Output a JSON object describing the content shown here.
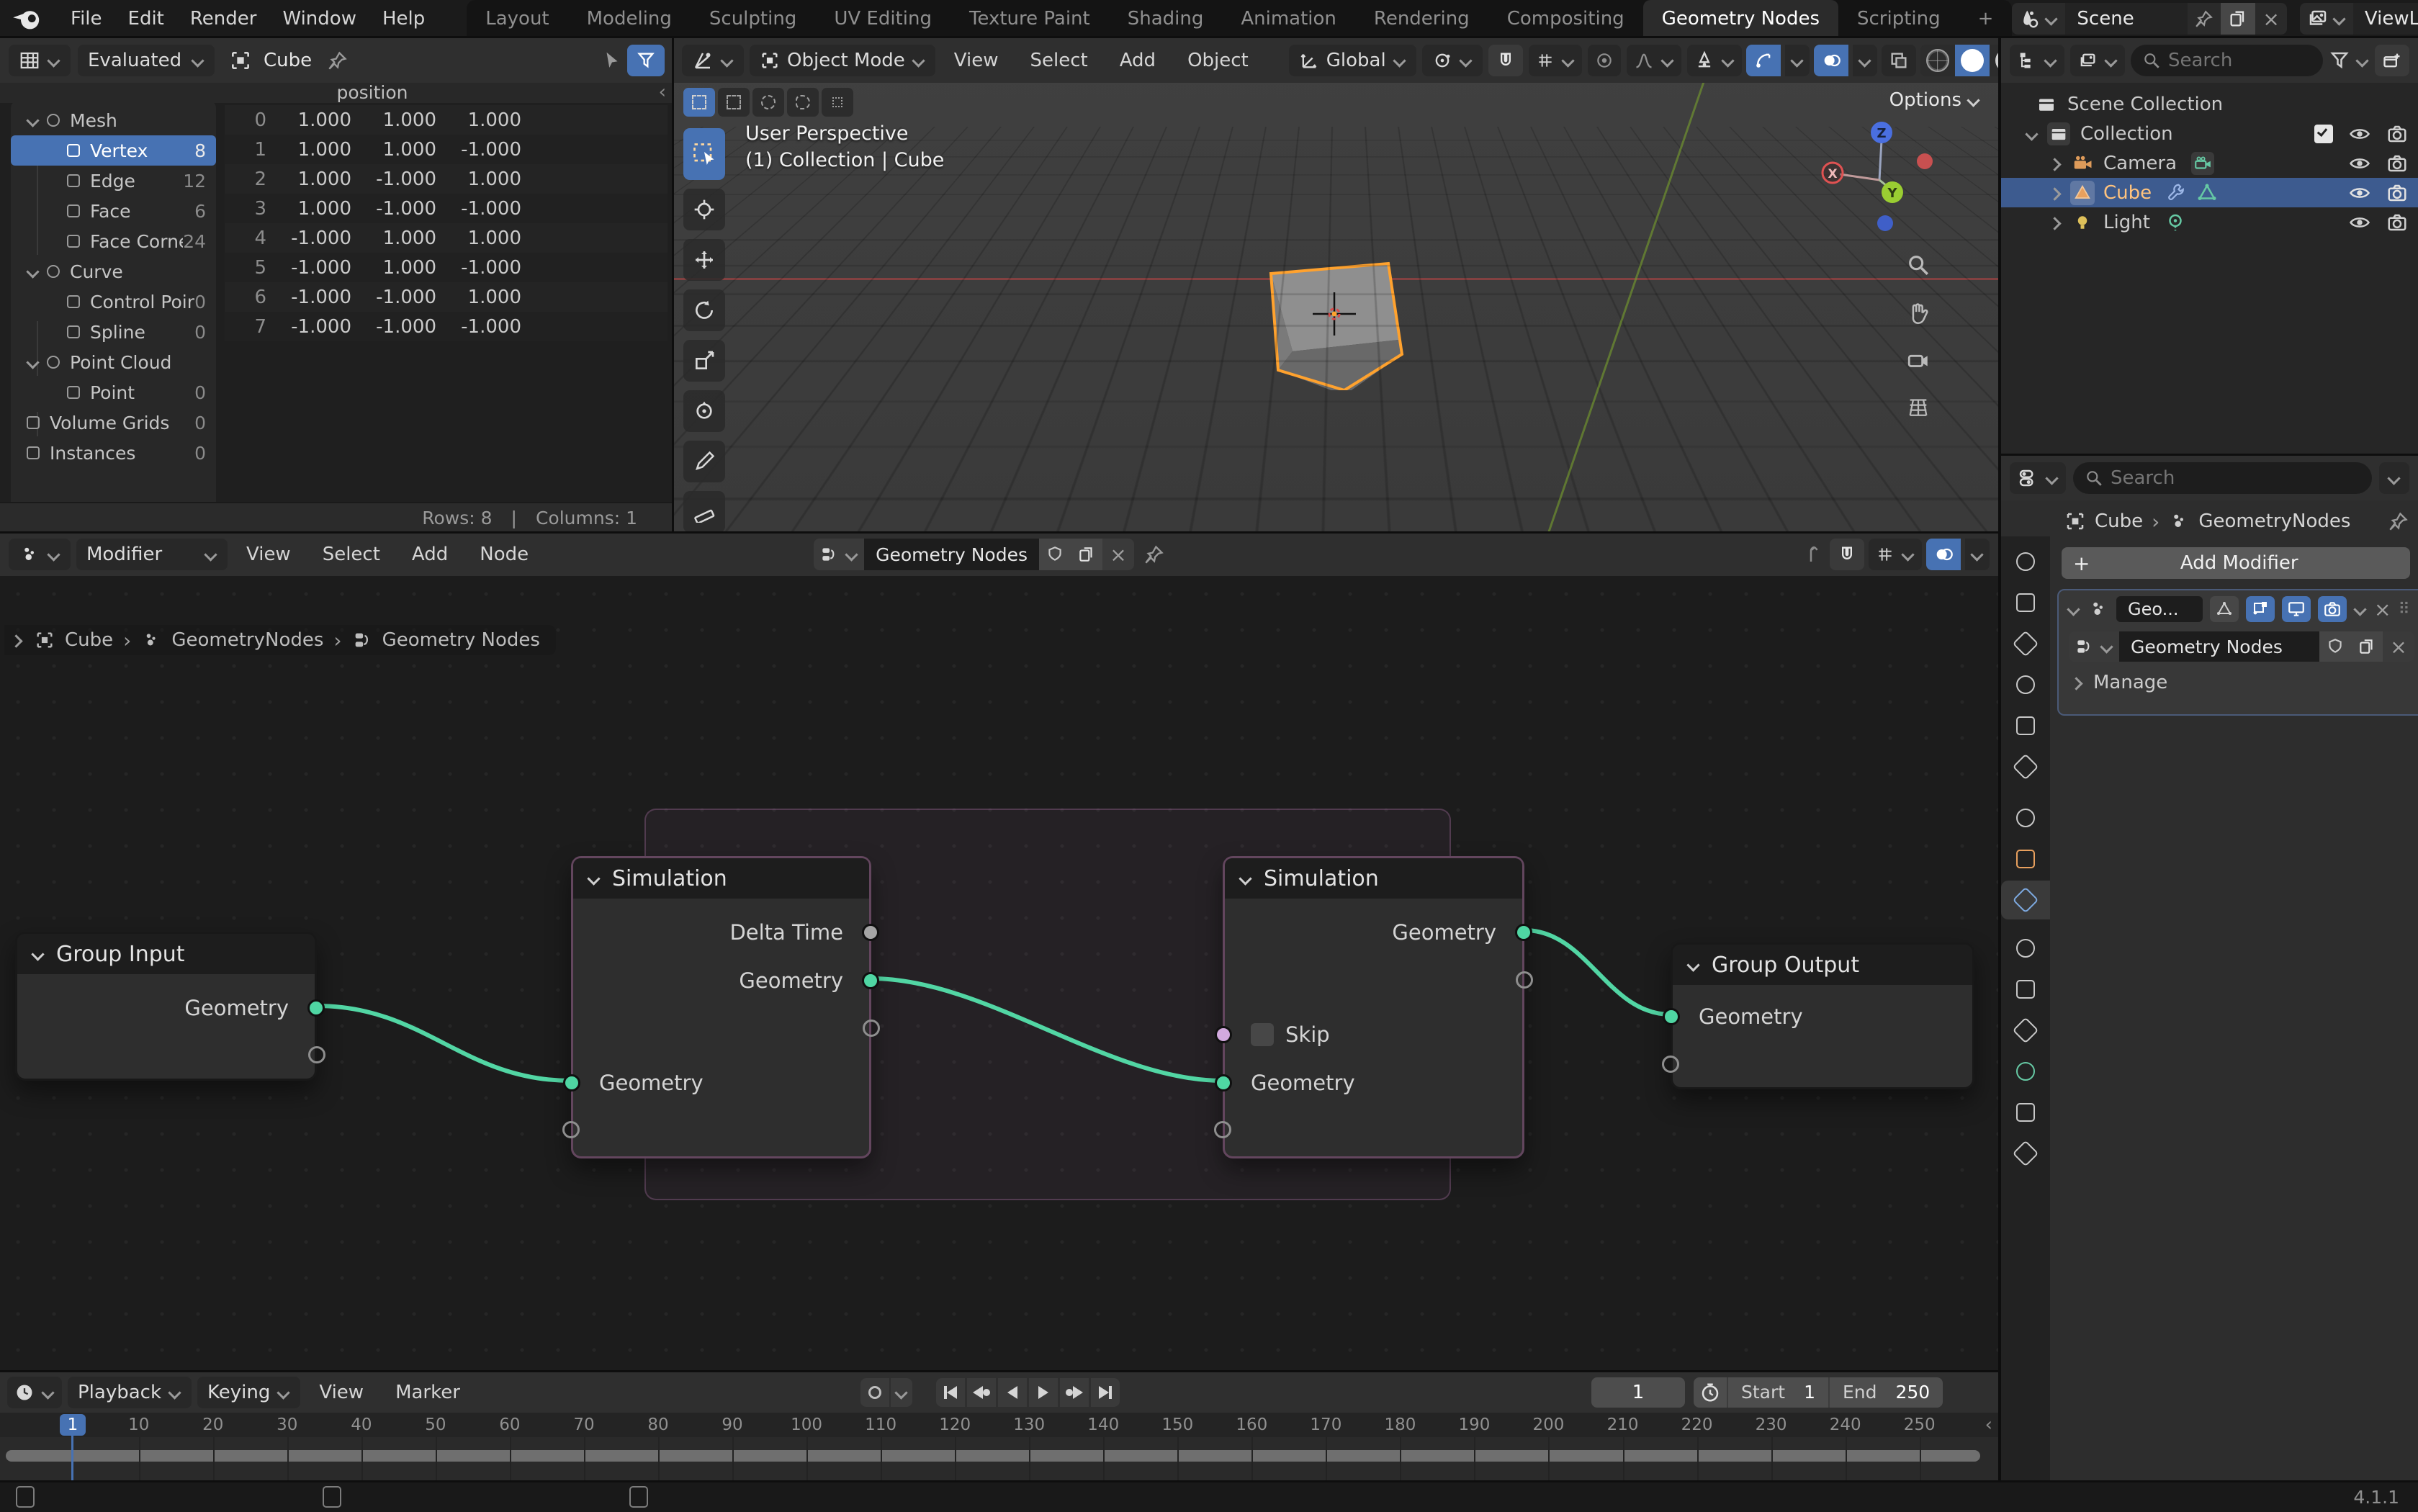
{
  "icons": {
    "close": "×",
    "plus": "+",
    "sep": "›",
    "collapse": "‹",
    "pipe": "|"
  },
  "topbar": {
    "menus": [
      "File",
      "Edit",
      "Render",
      "Window",
      "Help"
    ],
    "tabs": [
      "Layout",
      "Modeling",
      "Sculpting",
      "UV Editing",
      "Texture Paint",
      "Shading",
      "Animation",
      "Rendering",
      "Compositing",
      "Geometry Nodes",
      "Scripting"
    ],
    "scene_label": "Scene",
    "view_layer_label": "ViewLayer"
  },
  "spreadsheet": {
    "evaluation_mode": "Evaluated",
    "object_name": "Cube",
    "column_group": "position",
    "rows": [
      [
        "1.000",
        "1.000",
        "1.000"
      ],
      [
        "1.000",
        "1.000",
        "-1.000"
      ],
      [
        "1.000",
        "-1.000",
        "1.000"
      ],
      [
        "1.000",
        "-1.000",
        "-1.000"
      ],
      [
        "-1.000",
        "1.000",
        "1.000"
      ],
      [
        "-1.000",
        "1.000",
        "-1.000"
      ],
      [
        "-1.000",
        "-1.000",
        "1.000"
      ],
      [
        "-1.000",
        "-1.000",
        "-1.000"
      ]
    ],
    "tree": [
      {
        "label": "Mesh"
      },
      {
        "label": "Vertex",
        "count": "8"
      },
      {
        "label": "Edge",
        "count": "12"
      },
      {
        "label": "Face",
        "count": "6"
      },
      {
        "label": "Face Corner",
        "count": "24"
      },
      {
        "label": "Curve"
      },
      {
        "label": "Control Point",
        "count": "0"
      },
      {
        "label": "Spline",
        "count": "0"
      },
      {
        "label": "Point Cloud"
      },
      {
        "label": "Point",
        "count": "0"
      },
      {
        "label": "Volume Grids",
        "count": "0"
      },
      {
        "label": "Instances",
        "count": "0"
      }
    ],
    "footer": {
      "rows": "Rows: 8",
      "columns": "Columns: 1"
    }
  },
  "viewport": {
    "mode": "Object Mode",
    "menus": [
      "View",
      "Select",
      "Add",
      "Object"
    ],
    "orientation": "Global",
    "options_label": "Options",
    "overlay_title": "User Perspective",
    "overlay_subtitle": "(1) Collection | Cube",
    "gizmo": {
      "x": "X",
      "y": "Y",
      "z": "Z"
    }
  },
  "outliner": {
    "search_placeholder": "Search",
    "items": [
      {
        "label": "Scene Collection"
      },
      {
        "label": "Collection"
      },
      {
        "label": "Camera"
      },
      {
        "label": "Cube"
      },
      {
        "label": "Light"
      }
    ]
  },
  "properties": {
    "search_placeholder": "Search",
    "breadcrumb": {
      "object": "Cube",
      "modifier": "GeometryNodes"
    },
    "add_modifier_label": "Add Modifier",
    "modifier": {
      "name": "Geo...",
      "node_group": "Geometry Nodes",
      "manage_label": "Manage"
    }
  },
  "node_editor": {
    "mode": "Modifier",
    "menus": [
      "View",
      "Select",
      "Add",
      "Node"
    ],
    "node_group": "Geometry Nodes",
    "path": [
      "Cube",
      "GeometryNodes",
      "Geometry Nodes"
    ],
    "nodes": {
      "group_input": {
        "title": "Group Input",
        "output": "Geometry"
      },
      "sim_input": {
        "title": "Simulation",
        "out_delta": "Delta Time",
        "out_geo": "Geometry",
        "in_geo": "Geometry"
      },
      "sim_output": {
        "title": "Simulation",
        "out_geo": "Geometry",
        "in_skip": "Skip",
        "in_geo": "Geometry"
      },
      "group_output": {
        "title": "Group Output",
        "input": "Geometry"
      }
    }
  },
  "timeline": {
    "menus": {
      "playback": "Playback",
      "keying": "Keying",
      "view": "View",
      "marker": "Marker"
    },
    "current_frame": "1",
    "start_label": "Start",
    "start_value": "1",
    "end_label": "End",
    "end_value": "250",
    "ticks": [
      10,
      20,
      30,
      40,
      50,
      60,
      70,
      80,
      90,
      100,
      110,
      120,
      130,
      140,
      150,
      160,
      170,
      180,
      190,
      200,
      210,
      220,
      230,
      240,
      250
    ]
  },
  "statusbar": {
    "version": "4.1.1"
  }
}
